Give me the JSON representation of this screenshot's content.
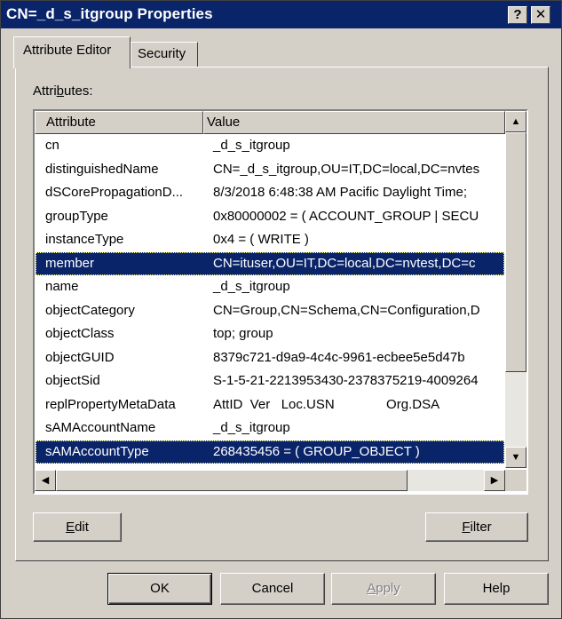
{
  "window": {
    "title": "CN=_d_s_itgroup Properties",
    "help_label": "?",
    "close_label": "✕"
  },
  "tabs": [
    {
      "label": "Attribute Editor",
      "active": true
    },
    {
      "label": "Security",
      "active": false
    }
  ],
  "attributes_label": {
    "pre": "Attri",
    "underlined": "b",
    "post": "utes:"
  },
  "columns": {
    "attribute": "Attribute",
    "value": "Value"
  },
  "rows": [
    {
      "attribute": "cn",
      "value": "_d_s_itgroup",
      "selected": false
    },
    {
      "attribute": "distinguishedName",
      "value": "CN=_d_s_itgroup,OU=IT,DC=local,DC=nvtes",
      "selected": false
    },
    {
      "attribute": "dSCorePropagationD...",
      "value": "8/3/2018 6:48:38 AM Pacific Daylight Time;",
      "selected": false
    },
    {
      "attribute": "groupType",
      "value": "0x80000002 = ( ACCOUNT_GROUP | SECU",
      "selected": false
    },
    {
      "attribute": "instanceType",
      "value": "0x4 = ( WRITE )",
      "selected": false
    },
    {
      "attribute": "member",
      "value": "CN=ituser,OU=IT,DC=local,DC=nvtest,DC=c",
      "selected": true
    },
    {
      "attribute": "name",
      "value": "_d_s_itgroup",
      "selected": false
    },
    {
      "attribute": "objectCategory",
      "value": "CN=Group,CN=Schema,CN=Configuration,D",
      "selected": false
    },
    {
      "attribute": "objectClass",
      "value": "top; group",
      "selected": false
    },
    {
      "attribute": "objectGUID",
      "value": "8379c721-d9a9-4c4c-9961-ecbee5e5d47b",
      "selected": false
    },
    {
      "attribute": "objectSid",
      "value": "S-1-5-21-2213953430-2378375219-4009264",
      "selected": false
    },
    {
      "attribute": "replPropertyMetaData",
      "value": "AttID  Ver   Loc.USN              Org.DSA",
      "selected": false
    },
    {
      "attribute": "sAMAccountName",
      "value": "_d_s_itgroup",
      "selected": false
    },
    {
      "attribute": "sAMAccountType",
      "value": "268435456 = ( GROUP_OBJECT )",
      "selected": true
    }
  ],
  "buttons": {
    "edit": {
      "underlined": "E",
      "rest": "dit"
    },
    "filter": {
      "underlined": "F",
      "rest": "ilter"
    },
    "ok": "OK",
    "cancel": "Cancel",
    "apply": {
      "underlined": "A",
      "rest": "pply"
    },
    "help": "Help"
  },
  "scroll": {
    "up_arrow": "▲",
    "down_arrow": "▼",
    "left_arrow": "◀",
    "right_arrow": "▶"
  },
  "icons": [
    "help-icon",
    "close-icon",
    "scroll-up-icon",
    "scroll-down-icon",
    "scroll-left-icon",
    "scroll-right-icon"
  ]
}
